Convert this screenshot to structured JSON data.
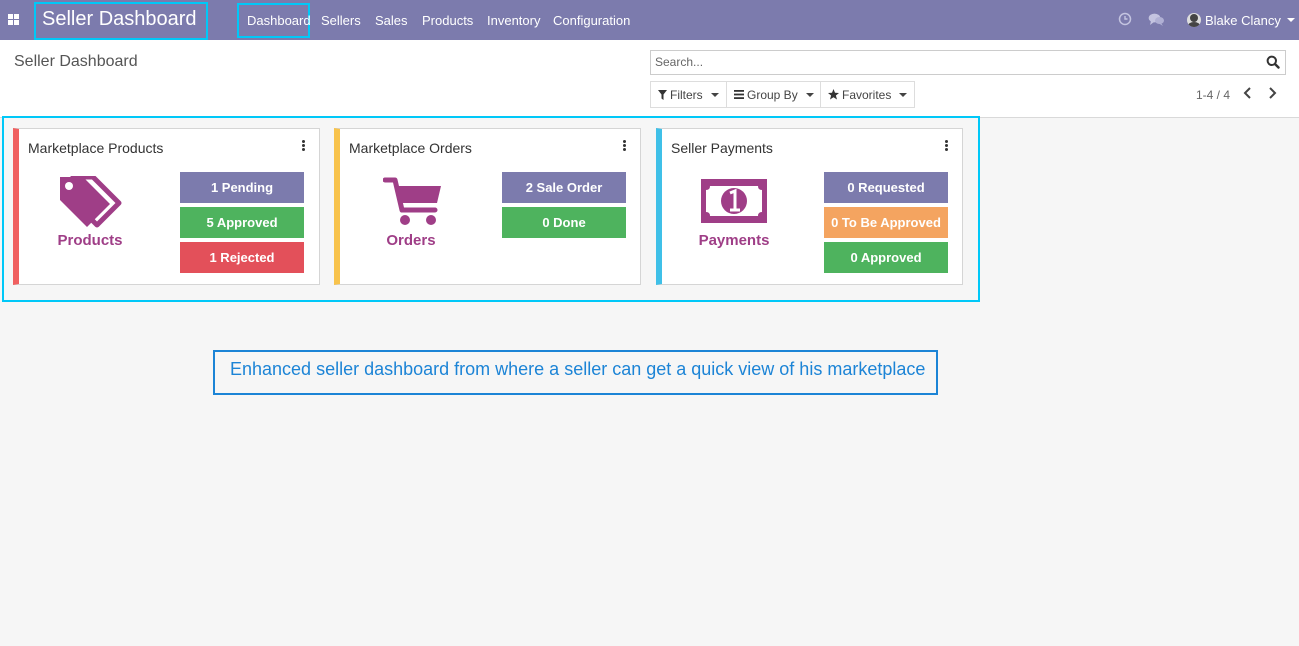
{
  "navbar": {
    "brand": "Seller Dashboard",
    "menu": [
      "Dashboard",
      "Sellers",
      "Sales",
      "Products",
      "Inventory",
      "Configuration"
    ],
    "icons": [
      "apps-grid-icon",
      "clock-icon",
      "chat-icon",
      "user-avatar-icon"
    ],
    "user_name": "Blake Clancy"
  },
  "control_panel": {
    "title": "Seller Dashboard",
    "search_placeholder": "Search...",
    "filters_label": "Filters",
    "group_by_label": "Group By",
    "favorites_label": "Favorites",
    "pager": "1-4 / 4"
  },
  "cards": [
    {
      "title": "Marketplace Products",
      "label": "Products",
      "icon": "tags-icon",
      "stats": [
        {
          "text": "1 Pending",
          "color": "#7c7bad"
        },
        {
          "text": "5 Approved",
          "color": "#4eb35e"
        },
        {
          "text": "1 Rejected",
          "color": "#e3505a"
        }
      ]
    },
    {
      "title": "Marketplace Orders",
      "label": "Orders",
      "icon": "cart-icon",
      "stats": [
        {
          "text": "2 Sale Order",
          "color": "#7c7bad"
        },
        {
          "text": "0 Done",
          "color": "#4eb35e"
        }
      ]
    },
    {
      "title": "Seller Payments",
      "label": "Payments",
      "icon": "money-icon",
      "stats": [
        {
          "text": "0 Requested",
          "color": "#7c7bad"
        },
        {
          "text": "0 To Be Approved",
          "color": "#f4a460"
        },
        {
          "text": "0 Approved",
          "color": "#4eb35e"
        }
      ]
    }
  ],
  "colors": {
    "navbar": "#7c7bad",
    "highlight": "#00c8f8",
    "icon": "#9f3e87",
    "card_borders": [
      "#f06060",
      "#f8c34c",
      "#3fc0e8"
    ]
  },
  "note": "Enhanced seller dashboard from where a seller can get a quick view of his marketplace"
}
